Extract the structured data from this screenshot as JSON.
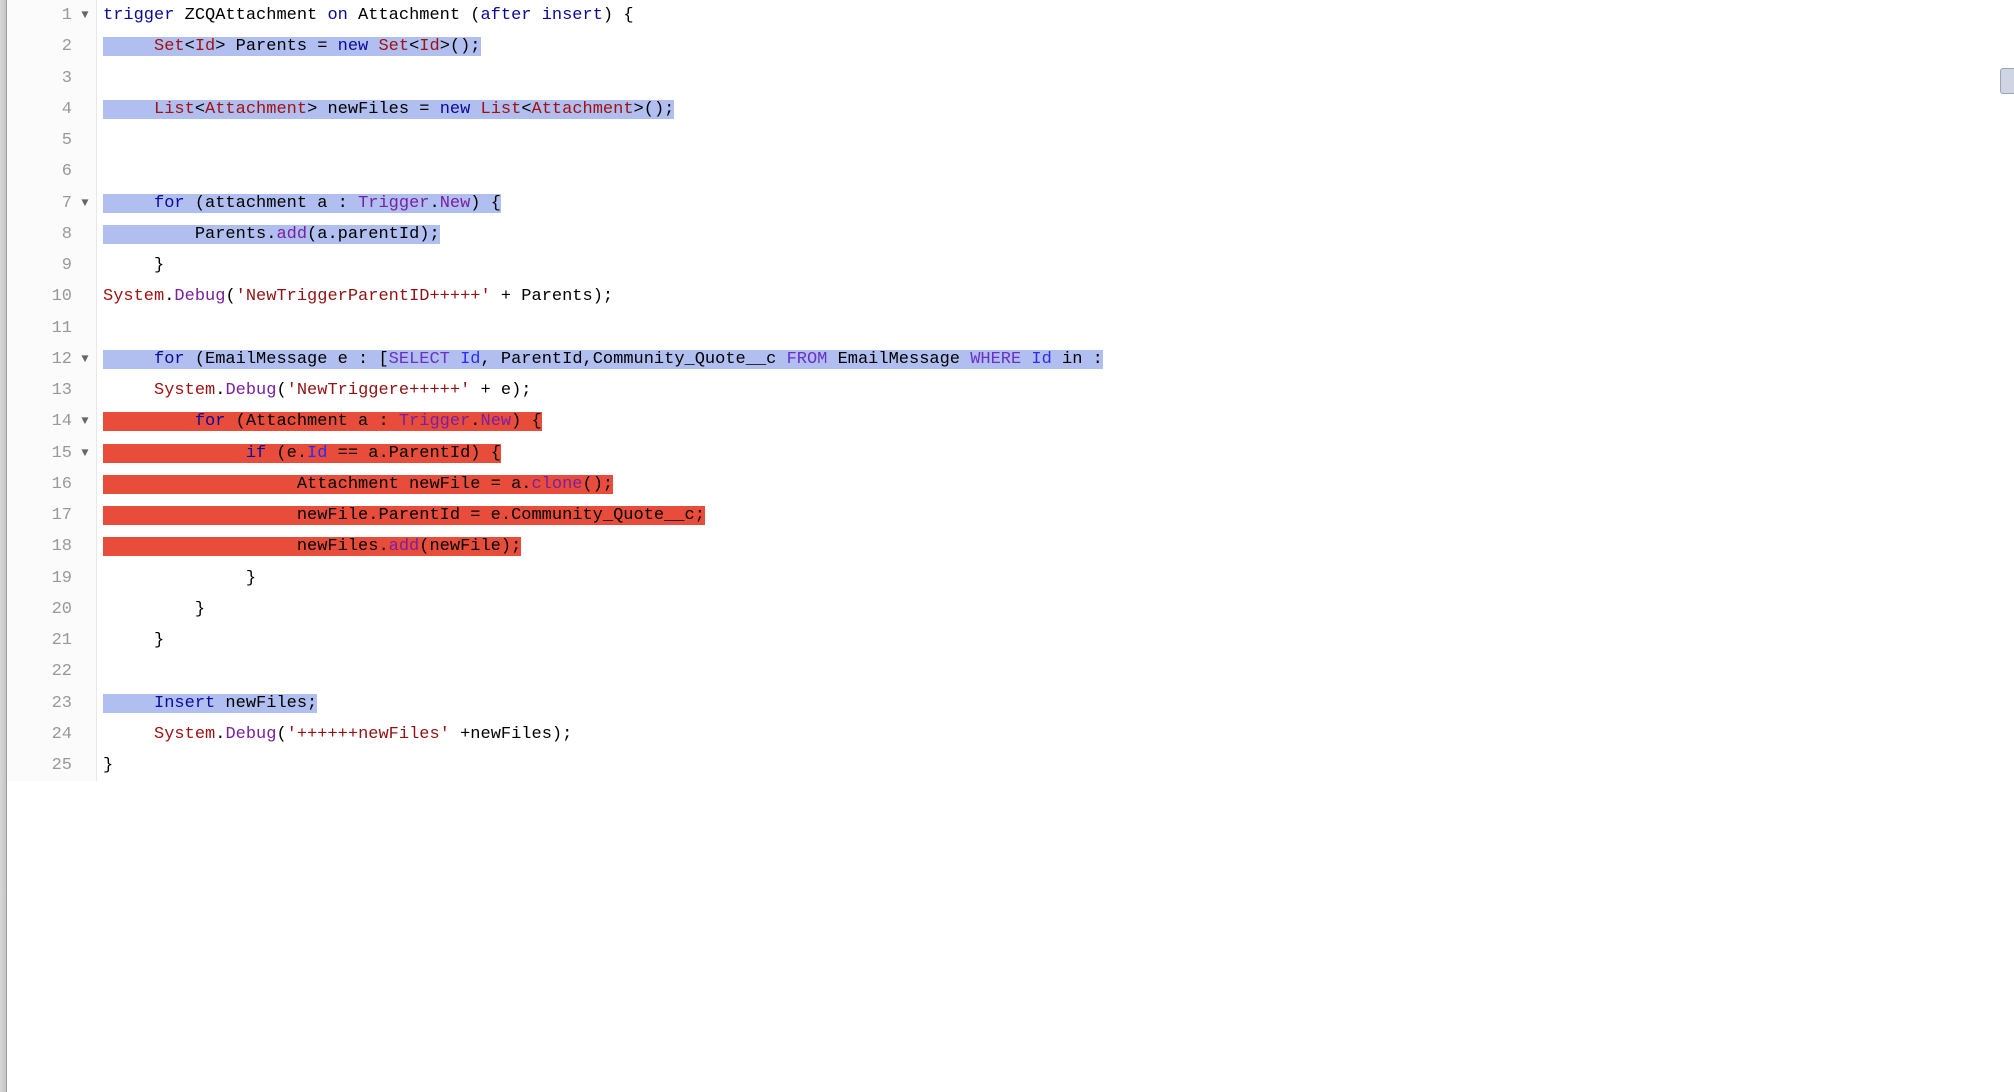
{
  "lines": [
    {
      "num": "1",
      "fold": "▼"
    },
    {
      "num": "2",
      "fold": ""
    },
    {
      "num": "3",
      "fold": ""
    },
    {
      "num": "4",
      "fold": ""
    },
    {
      "num": "5",
      "fold": ""
    },
    {
      "num": "6",
      "fold": ""
    },
    {
      "num": "7",
      "fold": "▼"
    },
    {
      "num": "8",
      "fold": ""
    },
    {
      "num": "9",
      "fold": ""
    },
    {
      "num": "10",
      "fold": ""
    },
    {
      "num": "11",
      "fold": ""
    },
    {
      "num": "12",
      "fold": "▼"
    },
    {
      "num": "13",
      "fold": ""
    },
    {
      "num": "14",
      "fold": "▼"
    },
    {
      "num": "15",
      "fold": "▼"
    },
    {
      "num": "16",
      "fold": ""
    },
    {
      "num": "17",
      "fold": ""
    },
    {
      "num": "18",
      "fold": ""
    },
    {
      "num": "19",
      "fold": ""
    },
    {
      "num": "20",
      "fold": ""
    },
    {
      "num": "21",
      "fold": ""
    },
    {
      "num": "22",
      "fold": ""
    },
    {
      "num": "23",
      "fold": ""
    },
    {
      "num": "24",
      "fold": ""
    },
    {
      "num": "25",
      "fold": ""
    }
  ],
  "t": {
    "l1_trigger": "trigger",
    "l1_name": " ZCQAttachment ",
    "l1_on": "on",
    "l1_att": " Attachment ",
    "l1_par1": "(",
    "l1_after": "after",
    "l1_sp": " ",
    "l1_insert": "insert",
    "l1_par2": ") {",
    "l2_pre": "     ",
    "l2_set": "Set",
    "l2_lt": "<",
    "l2_id": "Id",
    "l2_gt": "> Parents = ",
    "l2_new": "new",
    "l2_set2": " Set",
    "l2_lt2": "<",
    "l2_id2": "Id",
    "l2_gt2": ">();",
    "l4_pre": "     ",
    "l4_list": "List",
    "l4_lt": "<",
    "l4_att": "Attachment",
    "l4_gt": "> newFiles = ",
    "l4_new": "new",
    "l4_list2": " List",
    "l4_lt2": "<",
    "l4_att2": "Attachment",
    "l4_gt2": ">();",
    "l7_pre": "     ",
    "l7_for": "for",
    "l7_par": " (attachment a : ",
    "l7_trig": "Trigger",
    "l7_dot": ".",
    "l7_new": "New",
    "l7_end": ") {",
    "l8_pre": "         Parents.",
    "l8_add": "add",
    "l8_rest": "(a.parentId);",
    "l9": "     }",
    "l10_sys": "System",
    "l10_dot": ".",
    "l10_dbg": "Debug",
    "l10_par": "(",
    "l10_str": "'NewTriggerParentID+++++'",
    "l10_rest": " + Parents);",
    "l12_pre": "     ",
    "l12_for": "for",
    "l12_par": " (EmailMessage e : [",
    "l12_sel": "SELECT",
    "l12_sp1": " ",
    "l12_id": "Id",
    "l12_c1": ", ParentId,Community_Quote__c ",
    "l12_from": "FROM",
    "l12_em": " EmailMessage ",
    "l12_where": "WHERE",
    "l12_sp2": " ",
    "l12_id2": "Id",
    "l12_in": " in :",
    "l13_pre": "     ",
    "l13_sys": "System",
    "l13_dot": ".",
    "l13_dbg": "Debug",
    "l13_par": "(",
    "l13_str": "'NewTriggere+++++'",
    "l13_rest": " + e);",
    "l14_pre": "         ",
    "l14_for": "for",
    "l14_par": " (Attachment a : ",
    "l14_trig": "Trigger",
    "l14_dot": ".",
    "l14_new": "New",
    "l14_end": ") {",
    "l15_pre": "              ",
    "l15_if": "if",
    "l15_par": " (e.",
    "l15_id": "Id",
    "l15_eq": " == a.",
    "l15_pid": "ParentId",
    "l15_end": ") {",
    "l16_pre": "                   Attachment newFile = a.",
    "l16_clone": "clone",
    "l16_end": "();",
    "l17": "                   newFile.ParentId = e.Community_Quote__c;",
    "l18_pre": "                   newFiles.",
    "l18_add": "add",
    "l18_end": "(newFile);",
    "l19": "              }",
    "l20": "         }",
    "l21": "     }",
    "l23_pre": "     ",
    "l23_ins": "Insert",
    "l23_rest": " newFiles;",
    "l24_pre": "     ",
    "l24_sys": "System",
    "l24_dot": ".",
    "l24_dbg": "Debug",
    "l24_par": "(",
    "l24_str": "'++++++newFiles'",
    "l24_rest": " +newFiles);",
    "l25": "}"
  }
}
